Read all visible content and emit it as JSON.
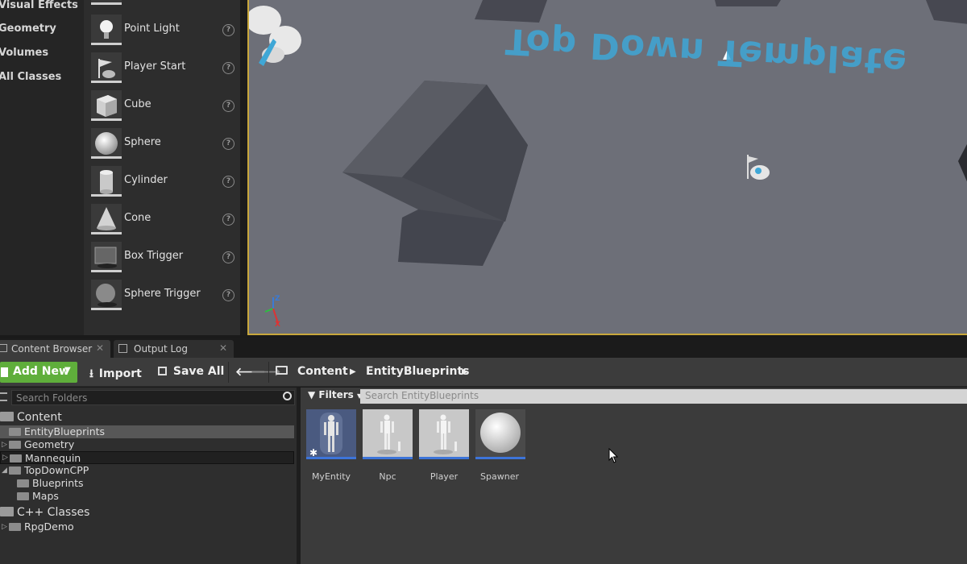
{
  "categories": [
    "Visual Effects",
    "Geometry",
    "Volumes",
    "All Classes"
  ],
  "place_items": [
    {
      "label": "Point Light",
      "icon": "point-light-icon"
    },
    {
      "label": "Player Start",
      "icon": "player-start-icon"
    },
    {
      "label": "Cube",
      "icon": "cube-icon"
    },
    {
      "label": "Sphere",
      "icon": "sphere-icon"
    },
    {
      "label": "Cylinder",
      "icon": "cylinder-icon"
    },
    {
      "label": "Cone",
      "icon": "cone-icon"
    },
    {
      "label": "Box Trigger",
      "icon": "box-trigger-icon"
    },
    {
      "label": "Sphere Trigger",
      "icon": "sphere-trigger-icon"
    }
  ],
  "viewport": {
    "floor_text": "Top Down Template",
    "axis_z": "Z",
    "axis_x": "X"
  },
  "tabs": [
    {
      "label": "Content Browser",
      "close": "✕"
    },
    {
      "label": "Output Log",
      "close": "✕"
    }
  ],
  "toolbar": {
    "add_new": "Add New",
    "import": "Import",
    "save_all": "Save All",
    "breadcrumb": [
      "Content",
      "EntityBlueprints"
    ]
  },
  "tree": {
    "search_placeholder": "Search Folders",
    "root": "Content",
    "entity_blueprints": "EntityBlueprints",
    "geometry": "Geometry",
    "mannequin": "Mannequin",
    "topdown": "TopDownCPP",
    "blueprints": "Blueprints",
    "maps": "Maps",
    "cpp_classes": "C++ Classes",
    "rpgdemo": "RpgDemo"
  },
  "assets_panel": {
    "filters_label": "Filters",
    "search_placeholder": "Search EntityBlueprints"
  },
  "assets": [
    {
      "name": "MyEntity",
      "icon": "blueprint-mannequin-icon"
    },
    {
      "name": "Npc",
      "icon": "character-blueprint-icon"
    },
    {
      "name": "Player",
      "icon": "character-blueprint-icon"
    },
    {
      "name": "Spawner",
      "icon": "sphere-blueprint-icon"
    }
  ],
  "colors": {
    "accent_green": "#5fae3b",
    "asset_underline": "#3d74d9",
    "viewport_border": "#c9a83c",
    "floor_text": "#3fa7d6"
  }
}
